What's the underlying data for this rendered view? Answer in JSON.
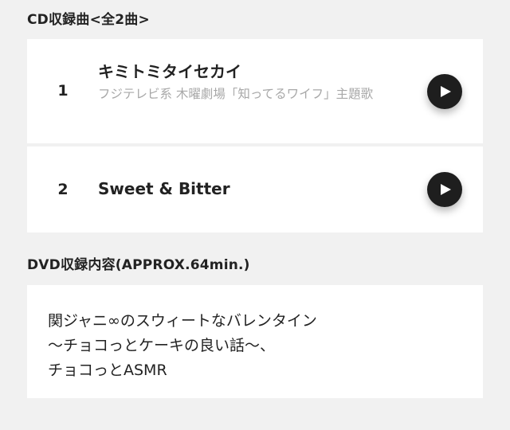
{
  "cd_section": {
    "title": "CD収録曲<全2曲>",
    "tracks": [
      {
        "number": "1",
        "title": "キミトミタイセカイ",
        "note": "フジテレビ系 木曜劇場「知ってるワイフ」主題歌",
        "play_icon": "play-icon"
      },
      {
        "number": "2",
        "title": "Sweet & Bitter",
        "play_icon": "play-icon"
      }
    ]
  },
  "dvd_section": {
    "title": "DVD収録内容(APPROX.64min.)",
    "lines": [
      "関ジャニ∞のスウィートなバレンタイン",
      "〜チョコっとケーキの良い話〜、",
      "チョコっとASMR"
    ]
  },
  "colors": {
    "background": "#f1f1f1",
    "card": "#ffffff",
    "play_button": "#1e1e1e",
    "note_text": "#a8a8a8"
  }
}
